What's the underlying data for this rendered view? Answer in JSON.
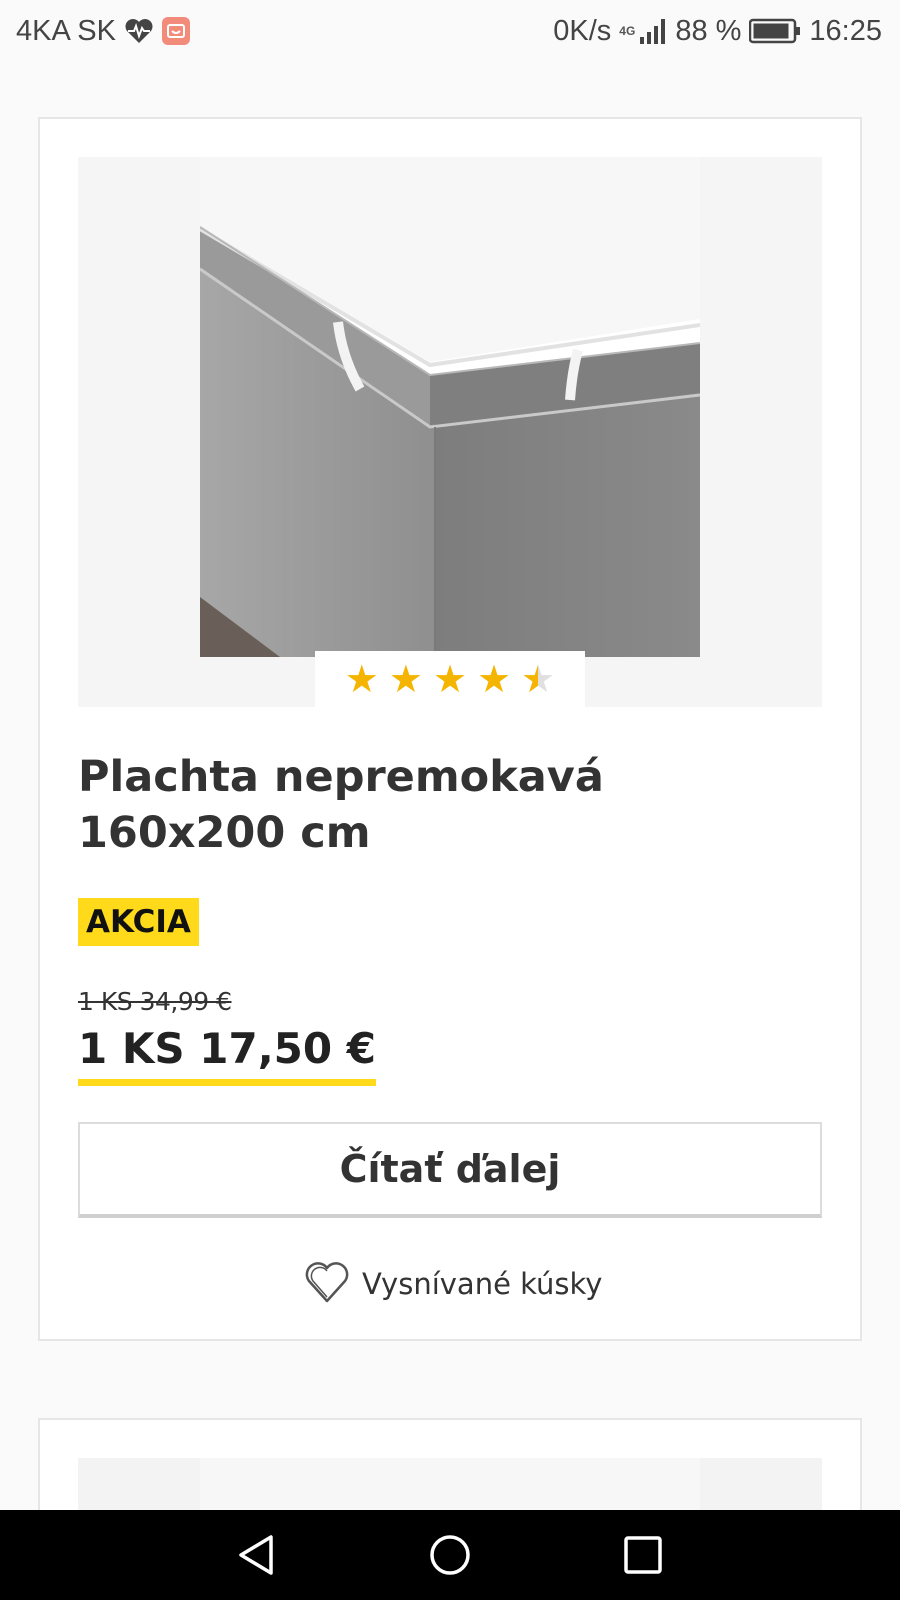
{
  "status_bar": {
    "carrier": "4KA SK",
    "network_speed": "0K/s",
    "network_type": "4G",
    "battery": "88 %",
    "time": "16:25",
    "icons": [
      "heart-pulse-icon",
      "app-notification-icon",
      "signal-icon",
      "battery-icon"
    ]
  },
  "product": {
    "rating": 4.5,
    "rating_max": 5,
    "title": "Plachta nepremokavá 160x200 cm",
    "badge": "AKCIA",
    "old_price": "1 KS 34,99 €",
    "new_price": "1 KS 17,50 €",
    "read_more_label": "Čítať ďalej",
    "wishlist_label": "Vysnívané kúsky"
  },
  "colors": {
    "accent_yellow": "#ffda1a",
    "star": "#f5b400",
    "text": "#333333"
  },
  "nav_bar": {
    "icons": [
      "back-icon",
      "home-icon",
      "recents-icon"
    ]
  }
}
